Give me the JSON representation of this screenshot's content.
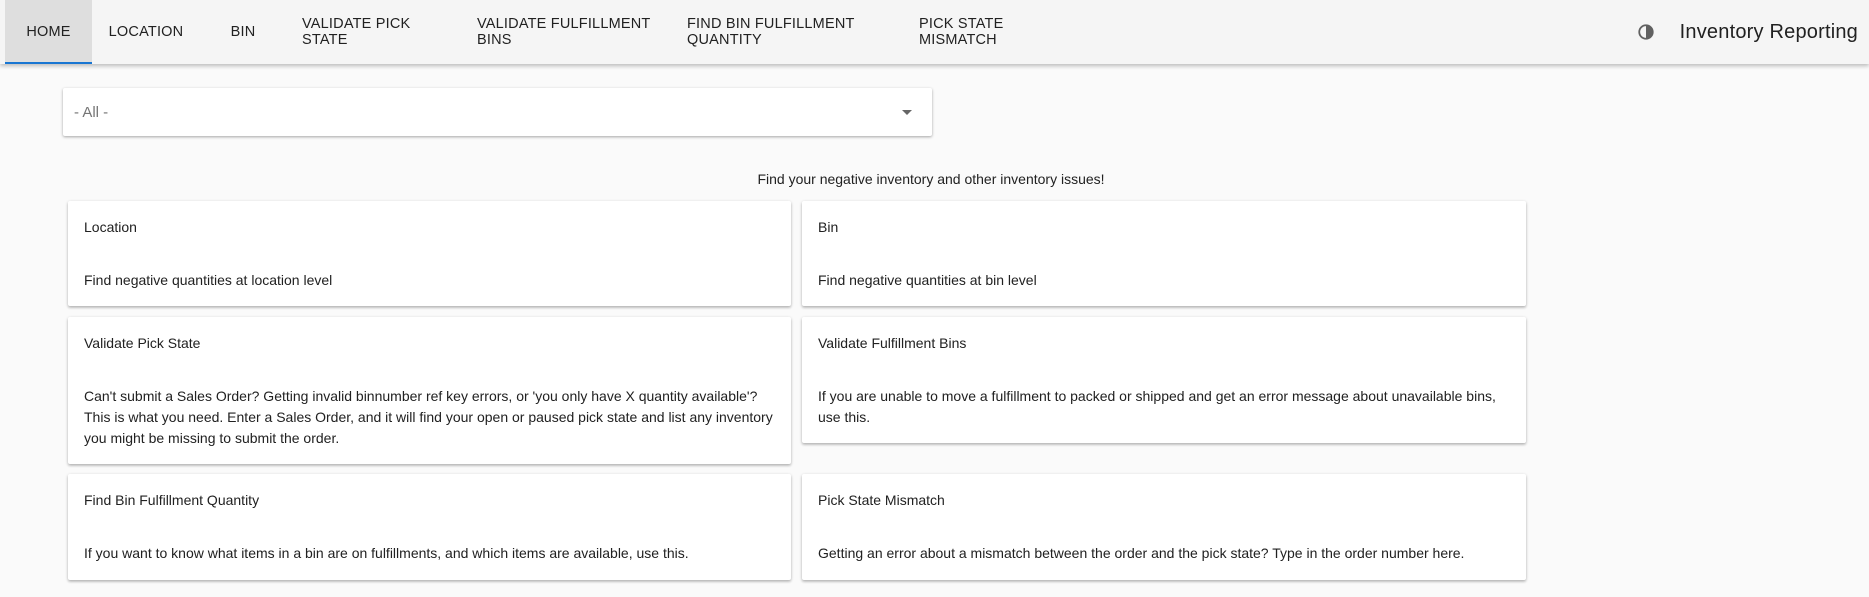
{
  "nav": {
    "tabs": [
      {
        "label": "HOME",
        "active": true
      },
      {
        "label": "LOCATION"
      },
      {
        "label": "BIN"
      },
      {
        "label": "VALIDATE PICK STATE"
      },
      {
        "label": "VALIDATE FULFILLMENT BINS"
      },
      {
        "label": "FIND BIN FULFILLMENT QUANTITY"
      },
      {
        "label": "PICK STATE MISMATCH"
      }
    ],
    "theme_icon": "contrast-icon",
    "app_title": "Inventory Reporting",
    "accent_color": "#1976d2"
  },
  "filter": {
    "selected": "- All -",
    "icon": "dropdown-arrow-icon"
  },
  "subtitle": "Find your negative inventory and other inventory issues!",
  "cards": [
    {
      "title": "Location",
      "description": "Find negative quantities at location level"
    },
    {
      "title": "Bin",
      "description": "Find negative quantities at bin level"
    },
    {
      "title": "Validate Pick State",
      "description": "Can't submit a Sales Order? Getting invalid binnumber ref key errors, or 'you only have X quantity available'? This is what you need. Enter a Sales Order, and it will find your open or paused pick state and list any inventory you might be missing to submit the order."
    },
    {
      "title": "Validate Fulfillment Bins",
      "description": "If you are unable to move a fulfillment to packed or shipped and get an error message about unavailable bins, use this."
    },
    {
      "title": "Find Bin Fulfillment Quantity",
      "description": "If you want to know what items in a bin are on fulfillments, and which items are available, use this."
    },
    {
      "title": "Pick State Mismatch",
      "description": "Getting an error about a mismatch between the order and the pick state? Type in the order number here."
    }
  ]
}
